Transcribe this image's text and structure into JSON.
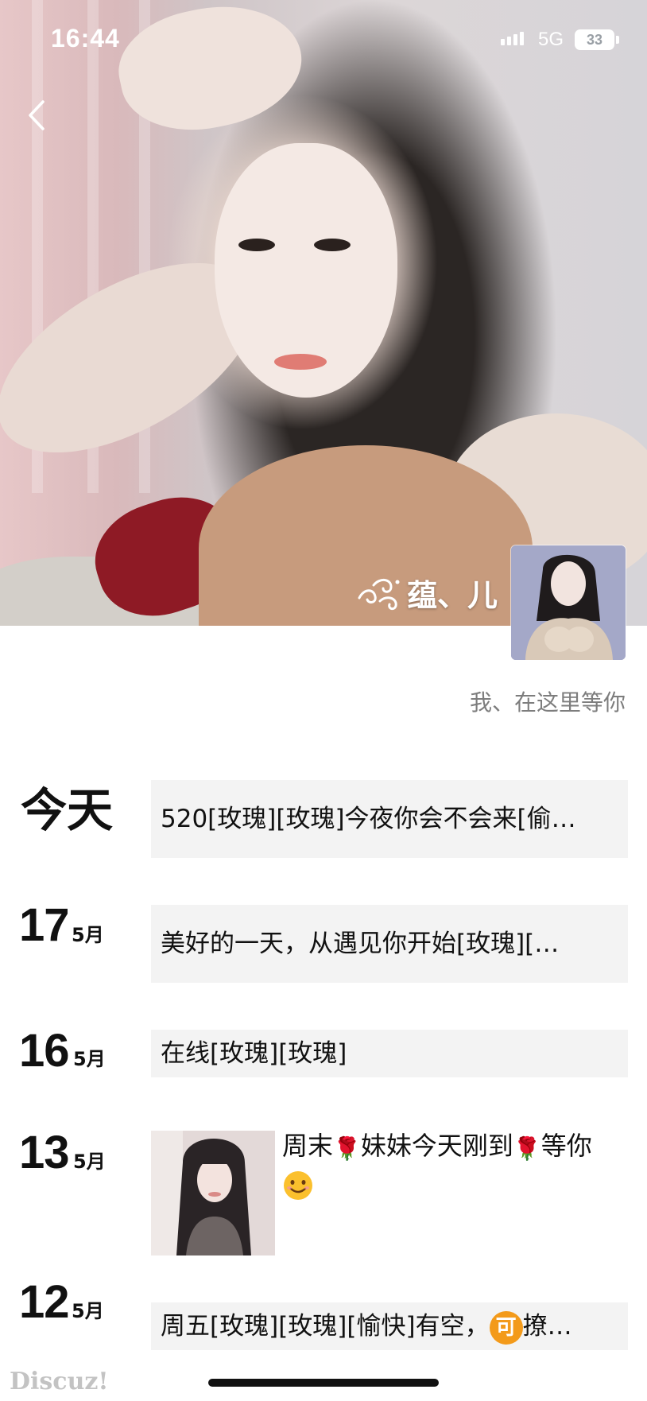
{
  "status_bar": {
    "time": "16:44",
    "network": "5G",
    "battery": "33"
  },
  "profile": {
    "name": "蕴、儿",
    "signature": "我、在这里等你"
  },
  "timeline": [
    {
      "day_label": "今天",
      "text": "520[玫瑰][玫瑰]今夜你会不会来[偷…"
    },
    {
      "day": "17",
      "month": "5月",
      "text": "美好的一天，从遇见你开始[玫瑰][…"
    },
    {
      "day": "16",
      "month": "5月",
      "text": "在线[玫瑰][玫瑰]"
    },
    {
      "day": "13",
      "month": "5月",
      "text_parts": [
        "周末",
        "妹妹今天刚到",
        "等你"
      ]
    },
    {
      "day": "12",
      "month": "5月",
      "text_prefix": "周五[玫瑰][玫瑰][愉快]有空，",
      "badge": "可",
      "text_suffix": "撩…"
    }
  ],
  "watermark": "Discuz!",
  "colors": {
    "bubble_bg": "#f3f3f3",
    "signature_text": "#7d7d7d",
    "badge_orange": "#f39a1a"
  }
}
